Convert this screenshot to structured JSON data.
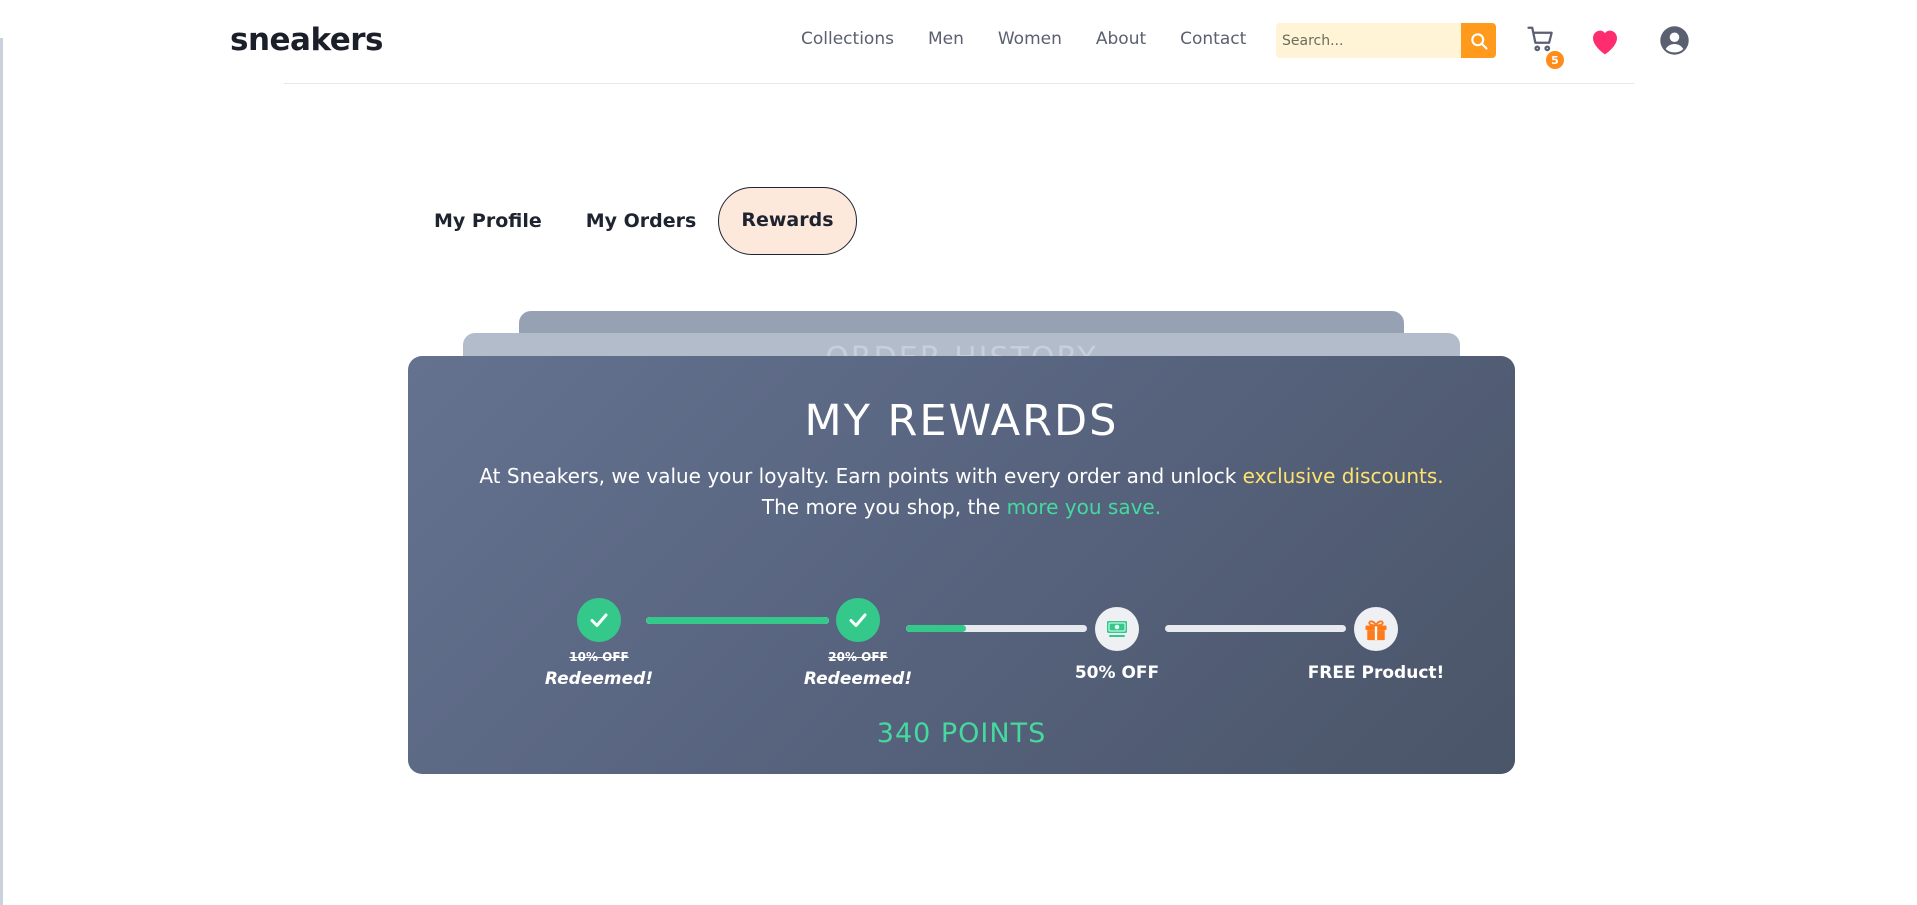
{
  "header": {
    "logo": "sneakers",
    "nav": [
      "Collections",
      "Men",
      "Women",
      "About",
      "Contact"
    ],
    "search_placeholder": "Search...",
    "cart_count": "5",
    "colors": {
      "accent": "#ff9a1c",
      "heart": "#ff2d6f"
    }
  },
  "tabs": [
    "My Profile",
    "My Orders",
    "Rewards"
  ],
  "active_tab": "Rewards",
  "background_card_title": "ORDER HISTORY",
  "rewards": {
    "title": "MY REWARDS",
    "desc_part1": "At Sneakers, we value your loyalty. Earn points with every order and unlock ",
    "desc_highlight1": "exclusive discounts.",
    "desc_part2": "The more you shop, the ",
    "desc_highlight2": "more you save.",
    "steps": [
      {
        "label": "10% OFF",
        "status": "Redeemed!",
        "icon": "check-icon"
      },
      {
        "label": "20% OFF",
        "status": "Redeemed!",
        "icon": "check-icon"
      },
      {
        "label": "50% OFF",
        "status": "",
        "icon": "cash-icon"
      },
      {
        "label": "FREE Product!",
        "status": "",
        "icon": "gift-icon"
      }
    ],
    "progress_fractions": [
      1.0,
      0.33,
      0.0
    ],
    "points": "340 POINTS",
    "colors": {
      "highlight_yellow": "#ffe26e",
      "highlight_green": "#45d9a0",
      "gift": "#ff7a1a"
    }
  }
}
